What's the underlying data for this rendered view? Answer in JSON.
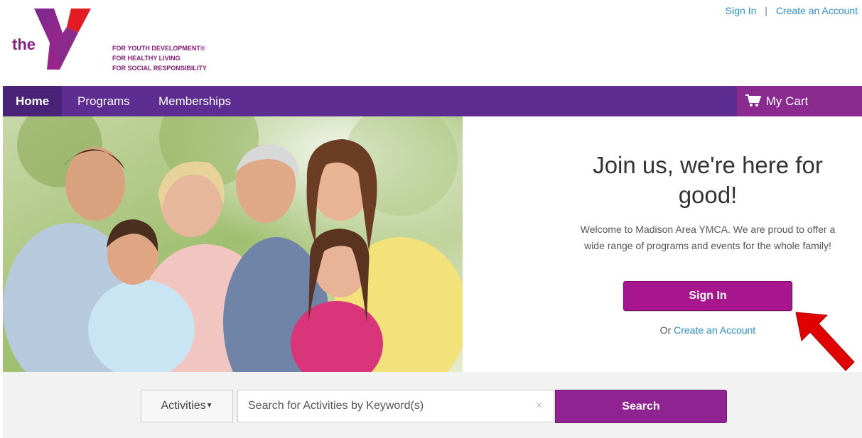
{
  "header": {
    "logo_text": "the",
    "logo_ymca": "YMCA",
    "tagline": [
      "FOR YOUTH DEVELOPMENT®",
      "FOR HEALTHY LIVING",
      "FOR SOCIAL RESPONSIBILITY"
    ],
    "sign_in_link": "Sign In",
    "separator": "|",
    "create_account_link": "Create an Account"
  },
  "nav": {
    "items": [
      {
        "label": "Home",
        "active": true
      },
      {
        "label": "Programs",
        "active": false
      },
      {
        "label": "Memberships",
        "active": false
      }
    ],
    "cart_label": "My Cart",
    "cart_icon": "cart-icon"
  },
  "hero": {
    "image_alt": "family-photo",
    "title": "Join us, we're here for good!",
    "welcome": "Welcome to Madison Area YMCA. We are proud to offer a wide range of programs and events for the whole family!",
    "signin_button": "Sign In",
    "or_text": "Or",
    "create_account_link": "Create an Account"
  },
  "search": {
    "category_label": "Activities",
    "placeholder": "Search for Activities by Keyword(s)",
    "clear_icon": "×",
    "button_label": "Search"
  },
  "colors": {
    "nav_bg": "#5d2d91",
    "brand_magenta": "#a7168f",
    "link_blue": "#2a8fd0",
    "arrow_red": "#e00000"
  }
}
